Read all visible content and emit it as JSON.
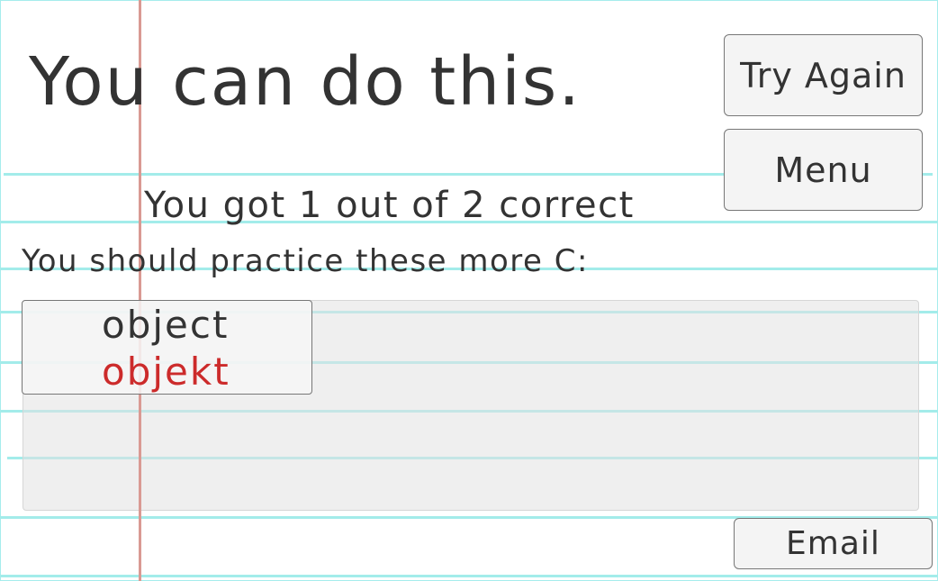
{
  "results": {
    "headline": "You can do this.",
    "score_text": "You got 1 out of 2 correct",
    "practice_label": "You should practice these more C:"
  },
  "buttons": {
    "try_again": "Try Again",
    "menu": "Menu",
    "email": "Email"
  },
  "practice_words": [
    {
      "correct": "object",
      "answer": "objekt"
    }
  ],
  "colors": {
    "rule_line": "#a3ecea",
    "margin_line": "#d99a93",
    "wrong_answer": "#cc2b2b",
    "text": "#333333"
  }
}
